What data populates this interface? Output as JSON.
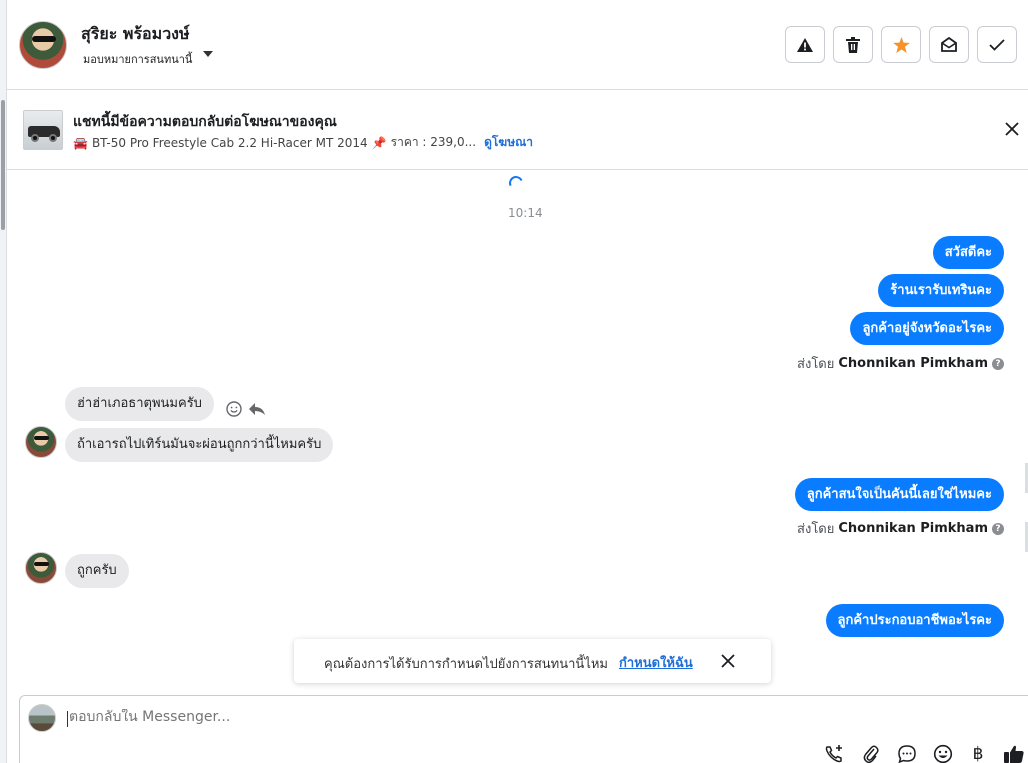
{
  "header": {
    "contact_name": "สุริยะ พร้อมวงษ์",
    "assign_label": "มอบหมายการสนทนานี้",
    "buttons": [
      {
        "name": "alert-icon"
      },
      {
        "name": "trash-icon"
      },
      {
        "name": "star-icon",
        "color": "#f5922a"
      },
      {
        "name": "envelope-open-icon"
      },
      {
        "name": "check-icon"
      }
    ]
  },
  "ad_banner": {
    "title": "แชทนี้มีข้อความตอบกลับต่อโฆษณาของคุณ",
    "car_emoji": "🚘",
    "model": "BT-50 Pro Freestyle Cab 2.2 Hi-Racer MT 2014",
    "pin_emoji": "📌",
    "price": "ราคา : 239,0...",
    "view_ad_link": "ดูโฆษณา"
  },
  "thread": {
    "timestamp": "10:14",
    "outgoing_group_1": [
      "สวัสดีคะ",
      "ร้านเรารับเทรินคะ",
      "ลูกค้าอยู่จังหวัดอะไรคะ"
    ],
    "sent_by_prefix": "ส่งโดย",
    "sent_by_name": "Chonnikan Pimkham",
    "incoming_group_1": [
      "ฮ่าฮ่าเภอธาตุพนมครับ",
      "ถ้าเอารถไปเทิร์นมันจะผ่อนถูกกว่านี้ไหมครับ"
    ],
    "outgoing_group_2": [
      "ลูกค้าสนใจเป็นคันนี้เลยใช่ไหมคะ"
    ],
    "incoming_group_2": [
      "ถูกครับ"
    ],
    "outgoing_group_3": [
      "ลูกค้าประกอบอาชีพอะไรคะ"
    ]
  },
  "notice": {
    "text": "คุณต้องการได้รับการกำหนดไปยังการสนทนานี้ไหม",
    "link": "กำหนดให้ฉัน"
  },
  "composer": {
    "placeholder": "ตอบกลับใน Messenger...",
    "tools": [
      "phone-plus-icon",
      "paperclip-icon",
      "chat-bubble-icon",
      "emoji-icon",
      "baht-icon",
      "thumbs-up-icon"
    ],
    "baht_symbol": "฿"
  },
  "colors": {
    "accent": "#0a7cff",
    "link": "#1e6fd9",
    "incoming_bubble": "#e9e9eb"
  }
}
